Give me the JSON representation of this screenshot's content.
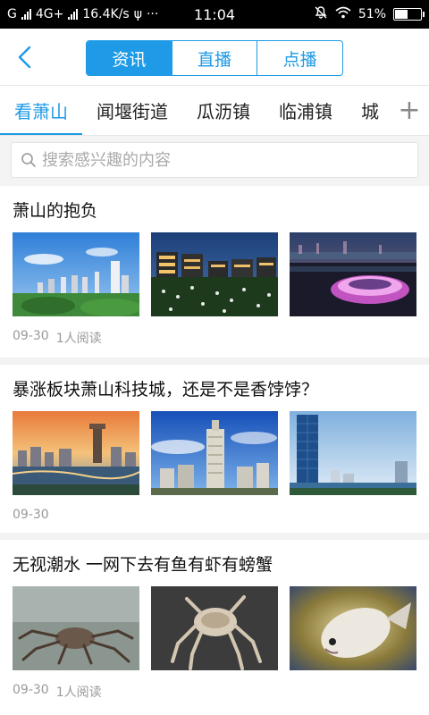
{
  "status_bar": {
    "carrier_left": "G",
    "network": "4G+",
    "speed": "16.4K/s",
    "usb": "ψ",
    "more": "···",
    "time": "11:04",
    "battery": "51%",
    "battery_level": 0.51
  },
  "header": {
    "tabs": [
      {
        "label": "资讯",
        "active": true
      },
      {
        "label": "直播",
        "active": false
      },
      {
        "label": "点播",
        "active": false
      }
    ],
    "accent_color": "#1e9ae6"
  },
  "categories": {
    "items": [
      {
        "label": "看萧山",
        "active": true
      },
      {
        "label": "闻堰街道",
        "active": false
      },
      {
        "label": "瓜沥镇",
        "active": false
      },
      {
        "label": "临浦镇",
        "active": false
      },
      {
        "label": "城",
        "active": false
      }
    ],
    "more_symbol": "+"
  },
  "search": {
    "placeholder": "搜索感兴趣的内容",
    "value": ""
  },
  "articles": [
    {
      "title": "萧山的抱负",
      "date": "09-30",
      "reads": "1人阅读",
      "thumbnails": [
        "city-skyline-photo",
        "night-buildings-photo",
        "stadium-night-photo"
      ]
    },
    {
      "title": "暴涨板块萧山科技城，还是不是香饽饽？",
      "date": "09-30",
      "reads": "",
      "thumbnails": [
        "sunset-city-photo",
        "tower-blue-sky-photo",
        "glass-tower-photo"
      ]
    },
    {
      "title": "无视潮水 一网下去有鱼有虾有螃蟹",
      "date": "09-30",
      "reads": "1人阅读",
      "thumbnails": [
        "crab-photo",
        "crab-closeup-photo",
        "fish-photo"
      ]
    }
  ]
}
